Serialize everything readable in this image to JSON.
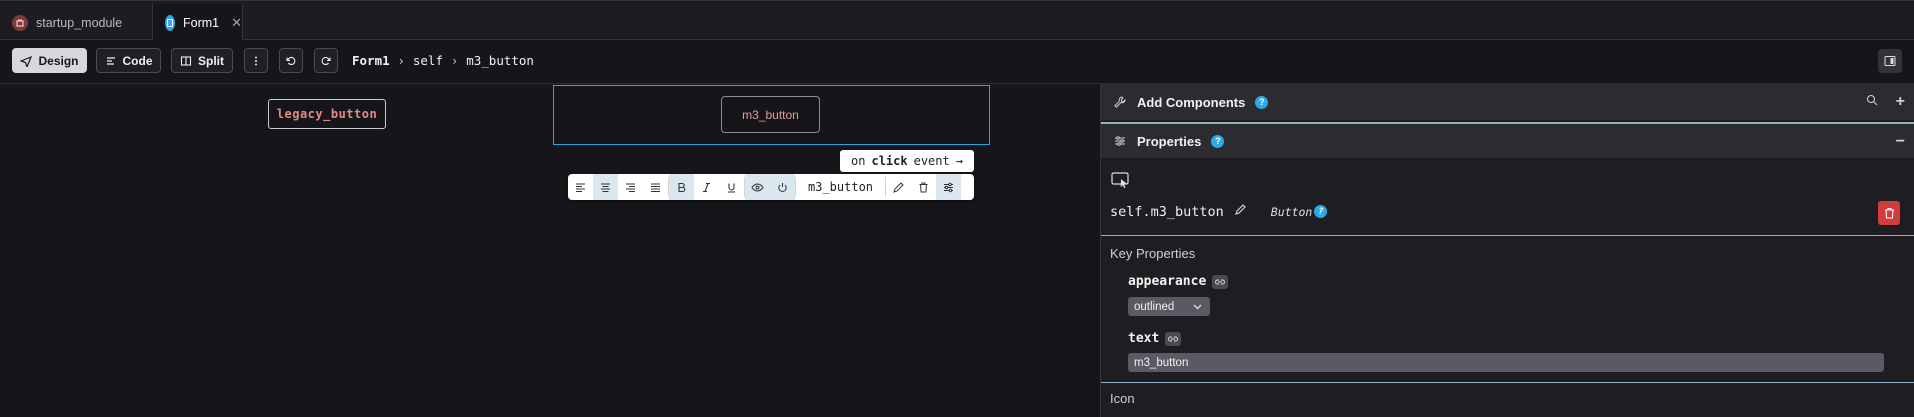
{
  "tabs": [
    {
      "label": "startup_module",
      "icon": "module-icon"
    },
    {
      "label": "Form1",
      "icon": "form-icon",
      "active": true
    }
  ],
  "toolbar": {
    "design_label": "Design",
    "code_label": "Code",
    "split_label": "Split",
    "breadcrumb": [
      "Form1",
      "self",
      "m3_button"
    ]
  },
  "canvas": {
    "legacy_button_label": "legacy_button",
    "m3_button_label": "m3_button",
    "onclick": {
      "prefix": "on",
      "keyword": "click",
      "suffix": "event"
    },
    "floating_toolbar_name": "m3_button"
  },
  "panel": {
    "add_components_title": "Add Components",
    "properties_title": "Properties",
    "help_glyph": "?",
    "component_name": "self.m3_button",
    "component_type": "Button",
    "key_properties_title": "Key Properties",
    "props": [
      {
        "label": "appearance",
        "value": "outlined"
      },
      {
        "label": "text",
        "value": "m3_button"
      }
    ],
    "icon_section_title": "Icon"
  },
  "colors": {
    "accent": "#2ea8e6",
    "selection": "#2aa7dc",
    "delete": "#d23c3c",
    "button_text": "#e48a8a"
  }
}
